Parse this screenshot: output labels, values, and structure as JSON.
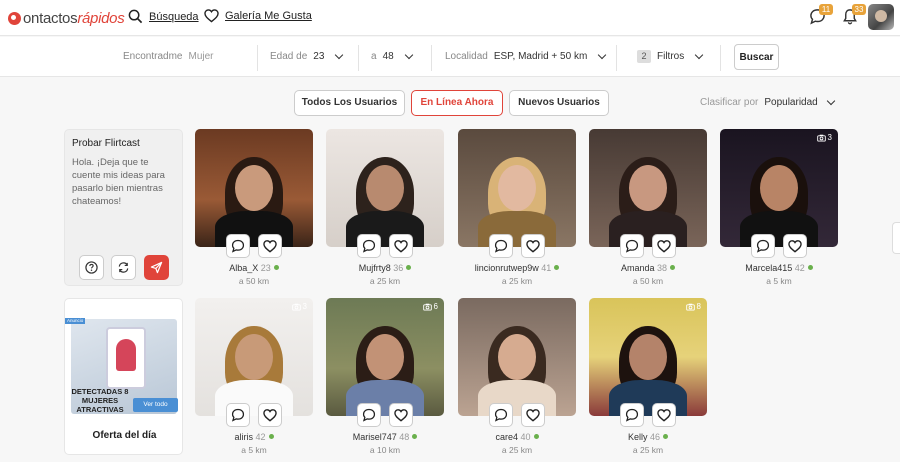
{
  "logo": {
    "part1": "ontactos",
    "part2": "rápidos"
  },
  "nav": {
    "search": "Búsqueda",
    "likes": "Galería Me Gusta"
  },
  "badges": {
    "messages": "11",
    "notifications": "33"
  },
  "filters": {
    "encontradme_label": "Encontradme",
    "encontradme_value": "Mujer",
    "edad_label": "Edad de",
    "edad_from": "23",
    "edad_to_label": "a",
    "edad_to": "48",
    "localidad_label": "Localidad",
    "localidad_value": "ESP, Madrid + 50 km",
    "filtros_count": "2",
    "filtros_label": "Filtros",
    "search_button": "Buscar"
  },
  "tabs": [
    {
      "label": "Todos Los Usuarios"
    },
    {
      "label": "En Línea Ahora"
    },
    {
      "label": "Nuevos Usuarios"
    }
  ],
  "sort": {
    "label": "Clasificar por",
    "value": "Popularidad"
  },
  "flirtcast": {
    "title": "Probar Flirtcast",
    "text": "Hola. ¡Deja que te cuente mis ideas para pasarlo bien mientras chateamos!"
  },
  "offer": {
    "tag": "Anuncio",
    "text": "DETECTADAS 8 MUJERES ATRACTIVAS",
    "cta": "Ver todo",
    "label": "Oferta del día"
  },
  "profiles": [
    {
      "name": "Alba_X",
      "age": "23",
      "distance": "a 50 km",
      "photos": ""
    },
    {
      "name": "Mujfrty8",
      "age": "36",
      "distance": "a 25 km",
      "photos": ""
    },
    {
      "name": "lincionrutwep9w",
      "age": "41",
      "distance": "a 25 km",
      "photos": ""
    },
    {
      "name": "Amanda",
      "age": "38",
      "distance": "a 50 km",
      "photos": ""
    },
    {
      "name": "Marcela415",
      "age": "42",
      "distance": "a 5 km",
      "photos": "3"
    },
    {
      "name": "aliris",
      "age": "42",
      "distance": "a 5 km",
      "photos": "3"
    },
    {
      "name": "Marisel747",
      "age": "48",
      "distance": "a 10 km",
      "photos": "6"
    },
    {
      "name": "care4",
      "age": "40",
      "distance": "a 25 km",
      "photos": ""
    },
    {
      "name": "Kelly",
      "age": "46",
      "distance": "a 25 km",
      "photos": "8"
    }
  ],
  "colors": {
    "brand": "#e0443a",
    "online": "#6ab04c",
    "badge": "#e8a33a"
  }
}
